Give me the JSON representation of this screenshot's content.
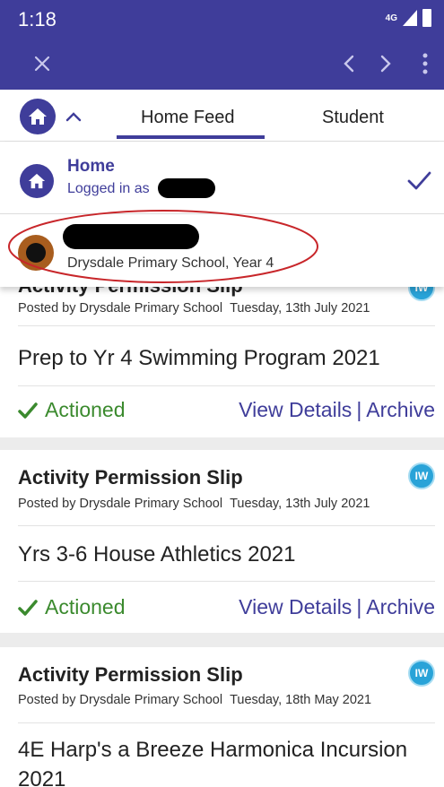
{
  "status_bar": {
    "time": "1:18",
    "network": "4G"
  },
  "app_bar": {
    "close_icon": "close-icon",
    "back_icon": "chevron-left-icon",
    "forward_icon": "chevron-right-icon",
    "menu_icon": "more-vert-icon"
  },
  "tabs": [
    {
      "label": "Home Feed",
      "active": true
    },
    {
      "label": "Student",
      "active": false
    }
  ],
  "dropdown": {
    "home_title": "Home",
    "logged_in_label": "Logged in as",
    "child_school": "Drysdale Primary School, Year 4"
  },
  "posts": [
    {
      "title": "Activity Permission Slip",
      "posted_by": "Posted by Drysdale Primary School",
      "date": "Tuesday, 13th July 2021",
      "body": "Prep to Yr 4 Swimming Program 2021",
      "status": "Actioned",
      "view_details": "View Details",
      "separator": "|",
      "archive": "Archive",
      "badge": "IW"
    },
    {
      "title": "Activity Permission Slip",
      "posted_by": "Posted by Drysdale Primary School",
      "date": "Tuesday, 13th July 2021",
      "body": "Yrs 3-6 House Athletics 2021",
      "status": "Actioned",
      "view_details": "View Details",
      "separator": "|",
      "archive": "Archive",
      "badge": "IW"
    },
    {
      "title": "Activity Permission Slip",
      "posted_by": "Posted by Drysdale Primary School",
      "date": "Tuesday, 18th May 2021",
      "body": "4E Harp's a Breeze Harmonica Incursion 2021",
      "badge": "IW"
    }
  ],
  "colors": {
    "primary": "#3f3d9a",
    "success": "#3b8a2e",
    "badge": "#29a3d8",
    "highlight_ring": "#c8262a"
  }
}
